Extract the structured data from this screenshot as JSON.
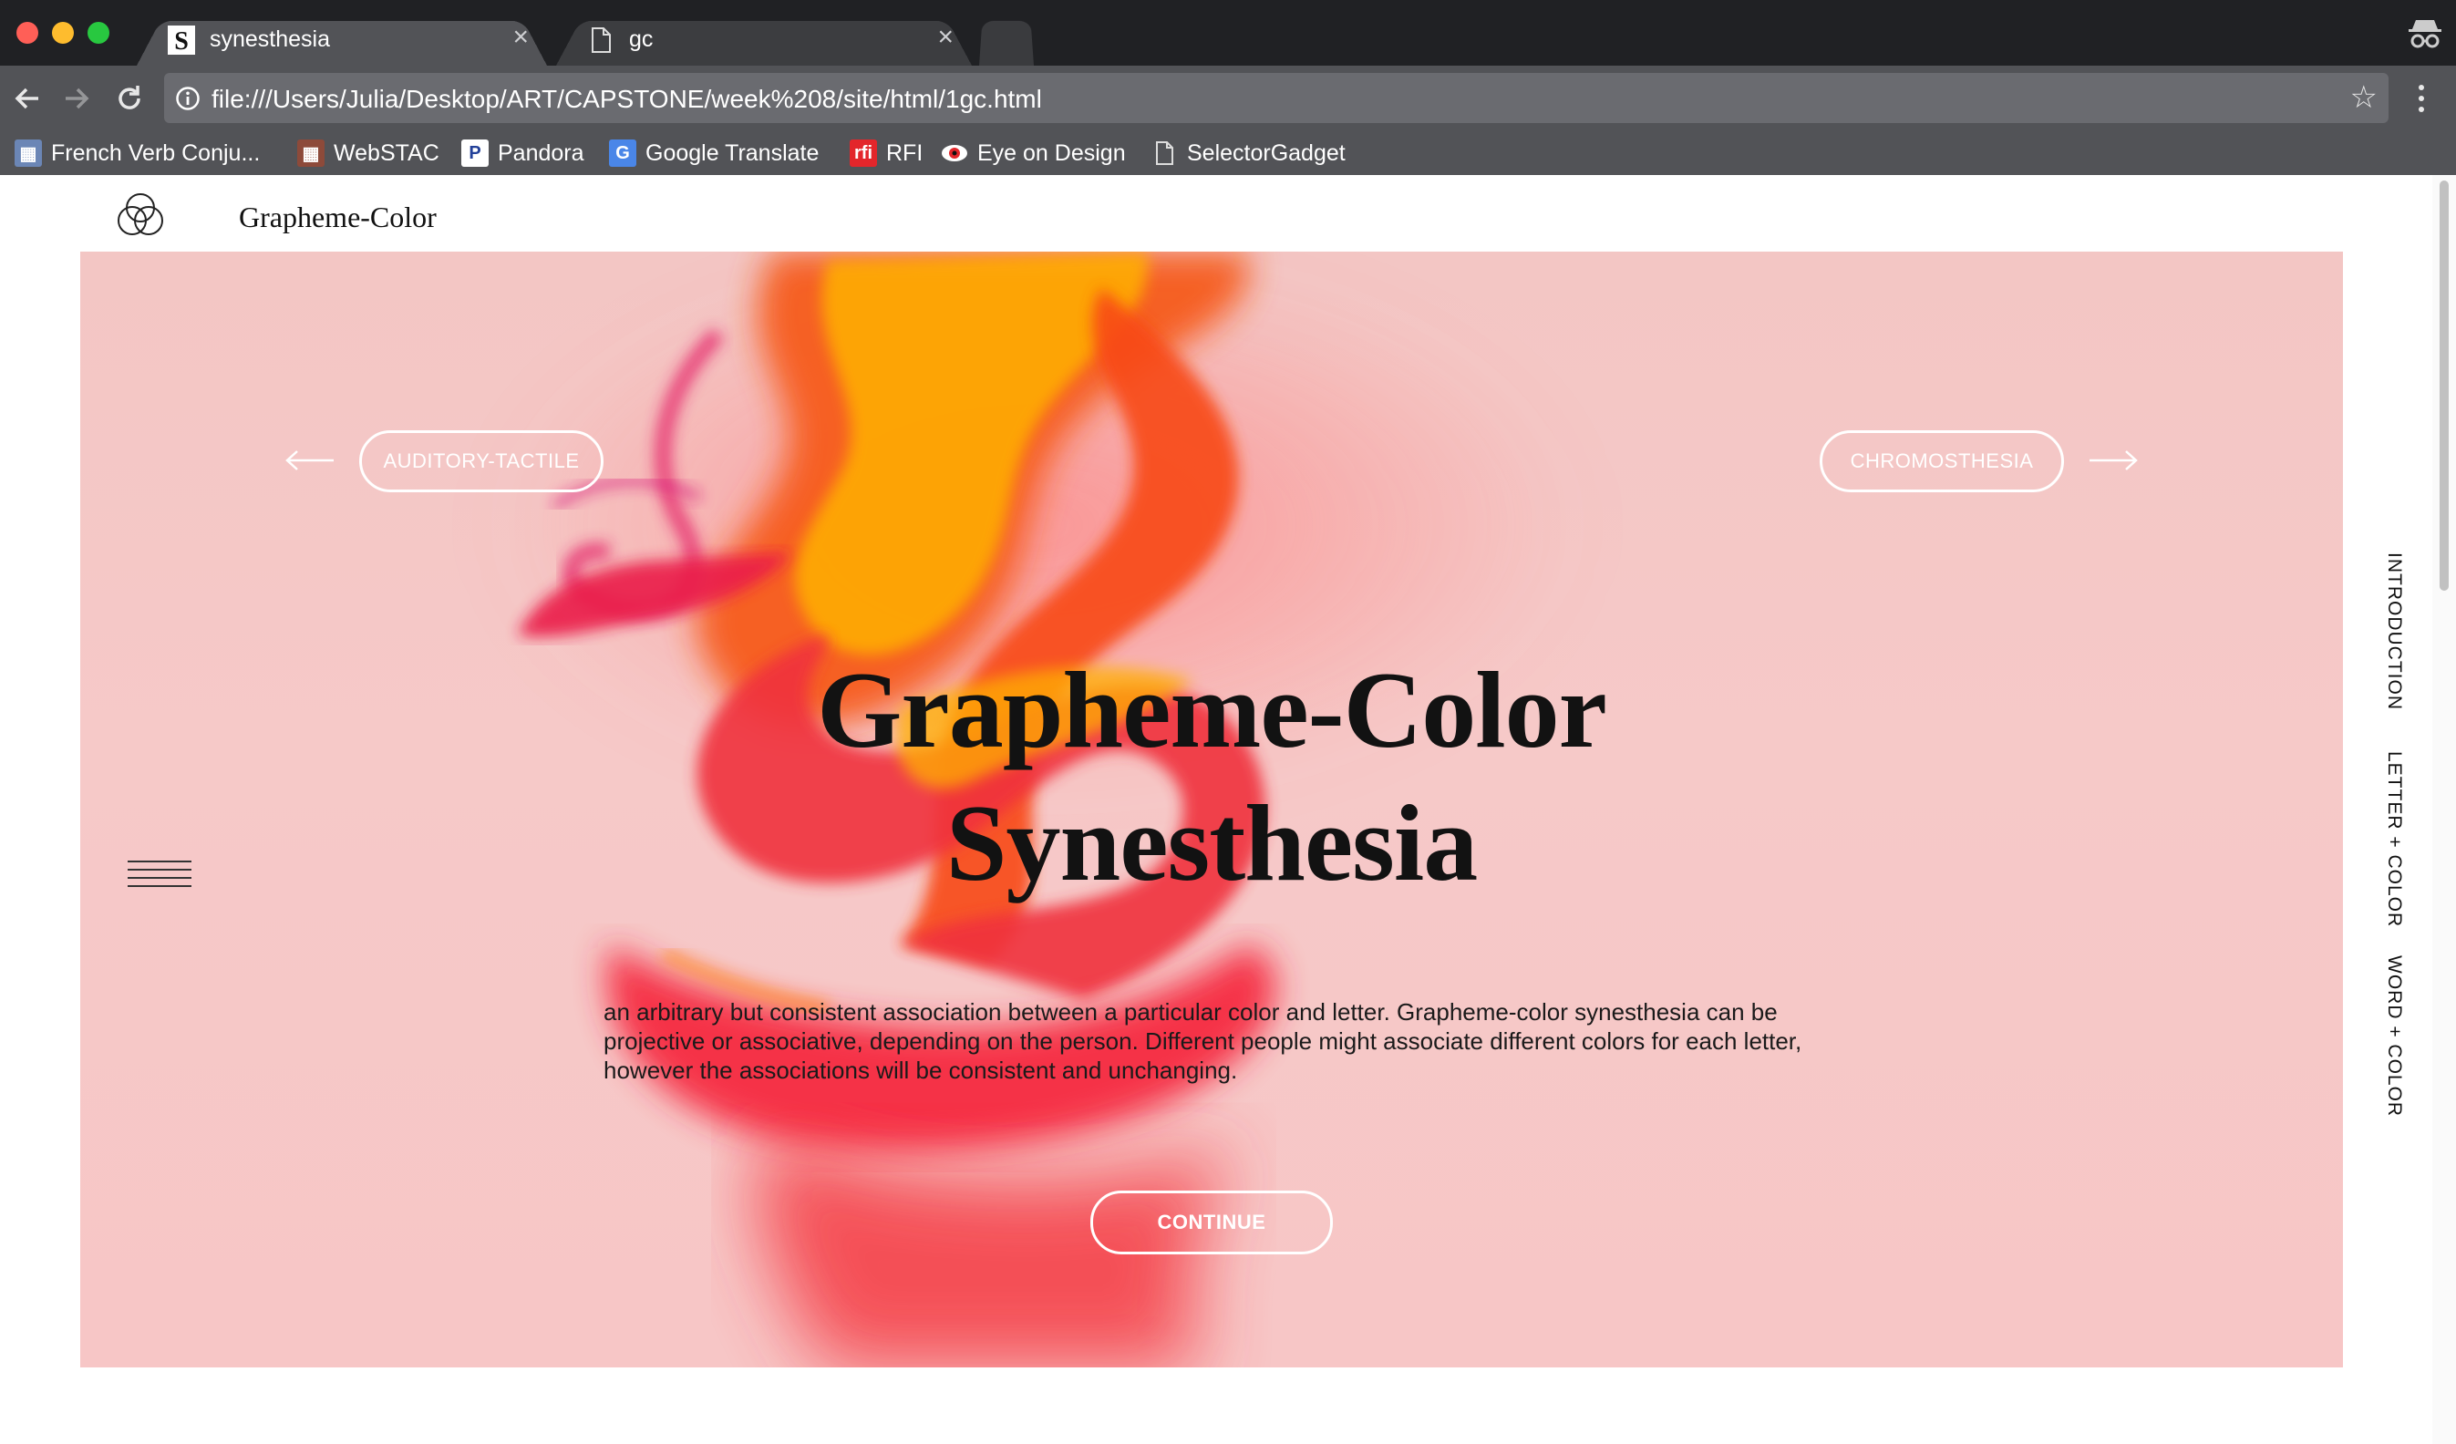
{
  "browser": {
    "tabs": [
      {
        "title": "synesthesia",
        "favicon": "s-favicon",
        "active": true
      },
      {
        "title": "gc",
        "favicon": "document-icon",
        "active": false
      }
    ],
    "url": "file:///Users/Julia/Desktop/ART/CAPSTONE/week%208/site/html/1gc.html",
    "bookmarks": [
      {
        "label": "French Verb Conju...",
        "icon": "grid-favicon"
      },
      {
        "label": "WebSTAC",
        "icon": "webstac-favicon"
      },
      {
        "label": "Pandora",
        "icon": "pandora-favicon"
      },
      {
        "label": "Google Translate",
        "icon": "google-translate-favicon"
      },
      {
        "label": "RFI",
        "icon": "rfi-favicon"
      },
      {
        "label": "Eye on Design",
        "icon": "eye-favicon"
      },
      {
        "label": "SelectorGadget",
        "icon": "document-icon"
      }
    ]
  },
  "site": {
    "title": "Grapheme-Color",
    "logo": "three-circles-logo"
  },
  "hero": {
    "prev_label": "AUDITORY-TACTILE",
    "next_label": "CHROMOSTHESIA",
    "headline_line1": "Grapheme-Color",
    "headline_line2": "Synesthesia",
    "description": "an arbitrary but consistent association between a particular color and letter. Grapheme-color synesthesia can be projective or associative, depending on the person. Different people might associate different colors for each letter, however the associations will be consistent and unchanging.",
    "continue_label": "CONTINUE"
  },
  "sidenav": {
    "items": [
      "INTRODUCTION",
      "LETTER + COLOR",
      "WORD + COLOR"
    ]
  },
  "colors": {
    "hero_background": "#f6c8c7",
    "ink_red": "#f1283a",
    "ink_orange": "#f86a10",
    "ink_yellow": "#ffb400",
    "chrome_dark": "#202124",
    "chrome_toolbar": "#525357"
  }
}
